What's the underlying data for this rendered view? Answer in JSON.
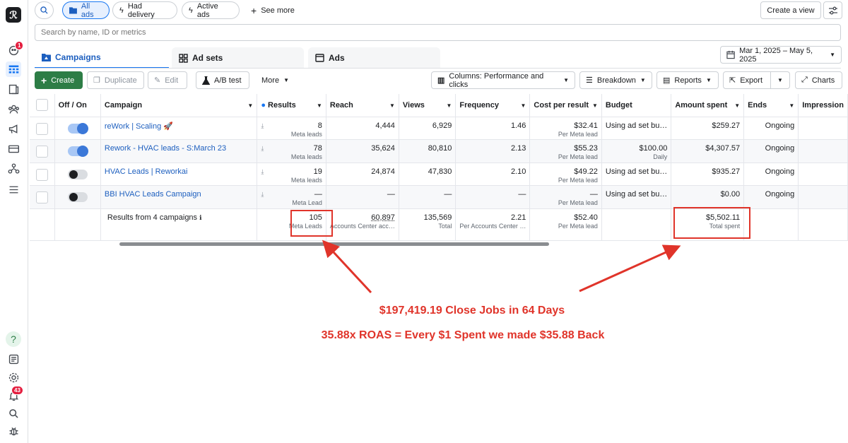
{
  "top": {
    "pills": [
      "All ads",
      "Had delivery",
      "Active ads",
      "See more"
    ],
    "create_view": "Create a view",
    "search_placeholder": "Search by name, ID or metrics"
  },
  "tabs": [
    "Campaigns",
    "Ad sets",
    "Ads"
  ],
  "date_range": "Mar 1, 2025 – May 5, 2025",
  "toolbar": {
    "create": "Create",
    "duplicate": "Duplicate",
    "edit": "Edit",
    "ab_test": "A/B test",
    "more": "More",
    "columns": "Columns: Performance and clicks",
    "breakdown": "Breakdown",
    "reports": "Reports",
    "export": "Export",
    "charts": "Charts"
  },
  "rail": {
    "notif_badge": "1",
    "alerts_badge": "43"
  },
  "table": {
    "headers": {
      "toggle": "Off / On",
      "campaign": "Campaign",
      "results": "Results",
      "reach": "Reach",
      "views": "Views",
      "frequency": "Frequency",
      "cost": "Cost per result",
      "budget": "Budget",
      "spent": "Amount spent",
      "ends": "Ends",
      "impressions": "Impression"
    },
    "rows": [
      {
        "name": "reWork | Scaling 🚀",
        "on": true,
        "results": "8",
        "results_sub": "Meta leads",
        "reach": "4,444",
        "views": "6,929",
        "frequency": "1.46",
        "cost": "$32.41",
        "cost_sub": "Per Meta lead",
        "budget": "Using ad set bu…",
        "budget_sub": "",
        "spent": "$259.27",
        "ends": "Ongoing"
      },
      {
        "name": "Rework - HVAC leads - S:March 23",
        "on": true,
        "results": "78",
        "results_sub": "Meta leads",
        "reach": "35,624",
        "views": "80,810",
        "frequency": "2.13",
        "cost": "$55.23",
        "cost_sub": "Per Meta lead",
        "budget": "$100.00",
        "budget_sub": "Daily",
        "spent": "$4,307.57",
        "ends": "Ongoing"
      },
      {
        "name": "HVAC Leads | Reworkai",
        "on": false,
        "results": "19",
        "results_sub": "Meta leads",
        "reach": "24,874",
        "views": "47,830",
        "frequency": "2.10",
        "cost": "$49.22",
        "cost_sub": "Per Meta lead",
        "budget": "Using ad set bu…",
        "budget_sub": "",
        "spent": "$935.27",
        "ends": "Ongoing"
      },
      {
        "name": "BBI HVAC Leads Campaign",
        "on": false,
        "results": "—",
        "results_sub": "Meta Lead",
        "reach": "—",
        "views": "—",
        "frequency": "—",
        "cost": "—",
        "cost_sub": "Per Meta lead",
        "budget": "Using ad set bu…",
        "budget_sub": "",
        "spent": "$0.00",
        "ends": "Ongoing"
      }
    ],
    "summary": {
      "label": "Results from 4 campaigns",
      "results": "105",
      "results_sub": "Meta Leads",
      "reach": "60,897",
      "reach_sub": "Accounts Center acc…",
      "views": "135,569",
      "views_sub": "Total",
      "frequency": "2.21",
      "frequency_sub": "Per Accounts Center …",
      "cost": "$52.40",
      "cost_sub": "Per Meta lead",
      "spent": "$5,502.11",
      "spent_sub": "Total spent"
    }
  },
  "annotation": {
    "line1": "$197,419.19 Close Jobs in 64 Days",
    "line2": "35.88x ROAS = Every $1 Spent we made $35.88 Back"
  },
  "colors": {
    "accent": "#1877f2",
    "annotation_red": "#e0342a",
    "create_green": "#2d7d46"
  }
}
